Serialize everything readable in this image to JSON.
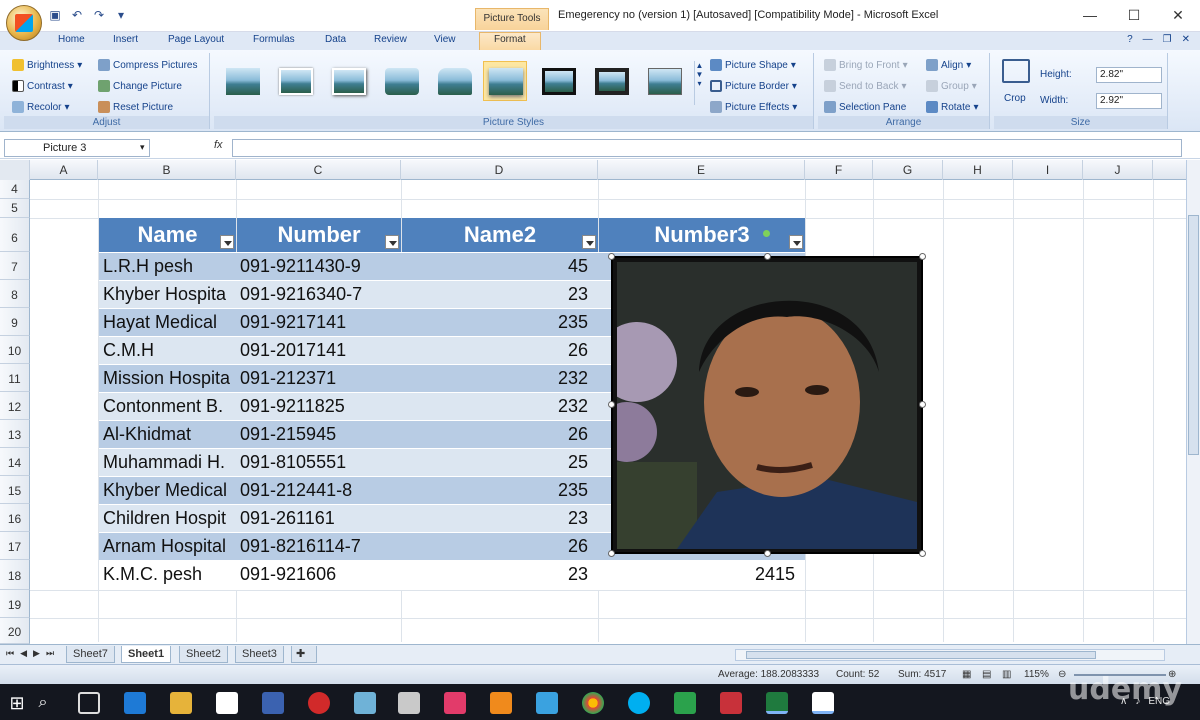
{
  "window": {
    "context_tab": "Picture Tools",
    "title": "Emegerency no (version 1) [Autosaved]  [Compatibility Mode] - Microsoft Excel"
  },
  "tabs": [
    "Home",
    "Insert",
    "Page Layout",
    "Formulas",
    "Data",
    "Review",
    "View",
    "Format"
  ],
  "ribbon": {
    "adjust": {
      "label": "Adjust",
      "items": [
        "Brightness",
        "Contrast",
        "Recolor",
        "Compress Pictures",
        "Change Picture",
        "Reset Picture"
      ]
    },
    "picture_styles": {
      "label": "Picture Styles",
      "items": [
        "Picture Shape",
        "Picture Border",
        "Picture Effects"
      ]
    },
    "arrange": {
      "label": "Arrange",
      "items": [
        "Bring to Front",
        "Send to Back",
        "Selection Pane",
        "Align",
        "Group",
        "Rotate"
      ]
    },
    "size": {
      "label": "Size",
      "crop": "Crop",
      "height_label": "Height:",
      "height_value": "2.82\"",
      "width_label": "Width:",
      "width_value": "2.92\""
    }
  },
  "formula_bar": {
    "name_box": "Picture 3",
    "fx": "fx",
    "value": ""
  },
  "columns": [
    "A",
    "B",
    "C",
    "D",
    "E",
    "F",
    "G",
    "H",
    "I",
    "J"
  ],
  "rows": [
    "4",
    "5",
    "6",
    "7",
    "8",
    "9",
    "10",
    "11",
    "12",
    "13",
    "14",
    "15",
    "16",
    "17",
    "18",
    "19",
    "20"
  ],
  "table": {
    "headers": [
      "Name",
      "Number",
      "Name2",
      "Number3"
    ],
    "rows": [
      [
        "L.R.H pesh",
        "091-9211430-9",
        "45"
      ],
      [
        "Khyber Hospita",
        "091-9216340-7",
        "23"
      ],
      [
        "Hayat Medical",
        "091-9217141",
        "235"
      ],
      [
        "C.M.H",
        "091-2017141",
        "26"
      ],
      [
        "Mission Hospita",
        "091-212371",
        "232"
      ],
      [
        "Contonment B.",
        "091-9211825",
        "232"
      ],
      [
        "Al-Khidmat",
        "091-215945",
        "26"
      ],
      [
        "Muhammadi H.",
        "091-8105551",
        "25"
      ],
      [
        "Khyber Medical",
        "091-212441-8",
        "235"
      ],
      [
        "Children Hospit",
        "091-261161",
        "23"
      ],
      [
        "Arnam Hospital",
        "091-8216114-7",
        "26"
      ],
      [
        "K.M.C. pesh",
        "091-921606",
        "23"
      ]
    ],
    "total": "2415"
  },
  "sheets": [
    "Sheet7",
    "Sheet1",
    "Sheet2",
    "Sheet3"
  ],
  "active_sheet": "Sheet1",
  "status": {
    "average": "Average: 188.2083333",
    "count": "Count: 52",
    "sum": "Sum: 4517",
    "zoom": "115%"
  },
  "taskbar": {
    "lang": "ENG",
    "watermark": "udemy"
  },
  "colors": {
    "header_blue": "#4f81bd",
    "band_light": "#dce6f1",
    "band_dark": "#b8cce4"
  }
}
